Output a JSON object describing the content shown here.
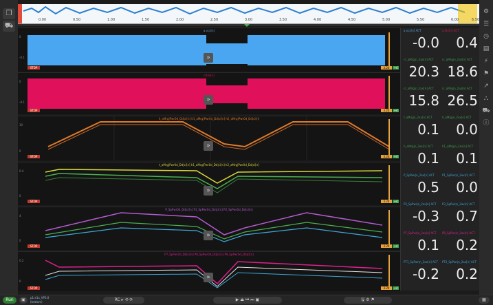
{
  "overview": {
    "ticks": [
      "0.00",
      "0.50",
      "1.00",
      "1.50",
      "2.00",
      "2.50",
      "3.00",
      "3.50",
      "4.00",
      "4.50",
      "5.00",
      "5.50",
      "6.00",
      "6.50"
    ]
  },
  "panels": [
    {
      "title": "a.vcx[n]",
      "y1": "0",
      "y2": "-0.1",
      "red": "STOP",
      "orange": "3.24",
      "green": "+4",
      "color": "#4aa6f0"
    },
    {
      "title": "d.hlx[n]",
      "y1": "0",
      "y2": "-0.1",
      "red": "STOP",
      "orange": "3.24",
      "green": "+4",
      "color": "#e0105a"
    },
    {
      "title": "h_aMrg|Pwr0d_Dd|ci[n]  h1_aMrg|Pwr0d_Dd|ci[n]  h2_aMrg|Pwr0d_Dd|ci[n]",
      "y1": "10",
      "y2": "0",
      "red": "STOP",
      "orange": "3.24",
      "green": "+4",
      "color": "#e07a2a"
    },
    {
      "title": "t_aMrg|Pwr0d_Dd|ci[n]  h1_aMrg|Pwr0d_Dd|ci[n]  h2_aMrg|Pwr0d_Dd|ci[n]",
      "y1": "0.4",
      "y2": "0",
      "red": "STOP",
      "orange": "3.24",
      "green": "+4",
      "color": "#d9d93a"
    },
    {
      "title": "P_SpPwr0d_Dd|ci[n]  P1_SpPwr0d_Dd|ci[n]  P2_SpPwr0d_Dd|ci[n]",
      "y1": "4",
      "y2": "0",
      "red": "STOP",
      "orange": "3.24",
      "green": "+4",
      "color": "#b45ad0"
    },
    {
      "title": "P7_SpPwr0d_Dd|ci[n]  P8_SpPwr0d_Dd|ci[n]  P9_SpPwr0d_Dd|ci[n]",
      "y1": "0.2",
      "y2": "0",
      "red": "STOP",
      "orange": "3.24",
      "green": "+4",
      "color": "#e02090"
    }
  ],
  "values": [
    {
      "l1": "a.vcx[n]  ACT",
      "l2": "a.hlx[n]  ACT",
      "v1": "-0.0",
      "v2": "0.4",
      "c1": "#4aa6f0",
      "c2": "#e0105a"
    },
    {
      "l1": "rc_aMrg|n_2ax[n]  ACT",
      "l2": "rc_aMrg|n_2ax[n]  ACT",
      "v1": "20.3",
      "v2": "18.6",
      "c1": "#3e9c4a",
      "c2": "#3e9c4a"
    },
    {
      "l1": "rc_aMrg|n_2ax[n]  ACT",
      "l2": "rc_aMrg|n_2ax[n]  ACT",
      "v1": "15.8",
      "v2": "26.5",
      "c1": "#3e9c4a",
      "c2": "#3e9c4a"
    },
    {
      "l1": "t_aMrg|n_2ax[n]  ACT",
      "l2": "h_aMrg|n_2ax[n]  ACT",
      "v1": "0.1",
      "v2": "0.0",
      "c1": "#3e9c4a",
      "c2": "#3e9c4a"
    },
    {
      "l1": "h_aMrg|n_2ax[n]  ACT",
      "l2": "h1_aMrg|n_2ax[n]  ACT",
      "v1": "0.1",
      "v2": "0.1",
      "c1": "#3e9c4a",
      "c2": "#3e9c4a"
    },
    {
      "l1": "P_SpPwr|n_2ax[n]  ACT",
      "l2": "P1_SpPwr|n_2ax[n]  ACT",
      "v1": "0.5",
      "v2": "0.0",
      "c1": "#3ea8d8",
      "c2": "#3ea8d8"
    },
    {
      "l1": "P2_SpPwr|n_2ax[n]  ACT",
      "l2": "P3_SpPwr|n_2ax[n]  ACT",
      "v1": "-0.3",
      "v2": "0.7",
      "c1": "#3ea8d8",
      "c2": "#3ea8d8"
    },
    {
      "l1": "P7_SpPwr|n_2ax[n]  ACT",
      "l2": "P8_SpPwr|n_2ax[n]  ACT",
      "v1": "0.1",
      "v2": "0.2",
      "c1": "#e02090",
      "c2": "#e02090"
    },
    {
      "l1": "PT1_SpPwr|n_2ax[n]  ACT",
      "l2": "PT2_SpPwr|n_2ax[n]  ACT",
      "v1": "-0.2",
      "v2": "0.2",
      "c1": "#3ea8d8",
      "c2": "#3ea8d8"
    }
  ],
  "bottom": {
    "run": "Run",
    "status1": "p1:e1x_VP3.0",
    "status2": "(bottom)"
  }
}
